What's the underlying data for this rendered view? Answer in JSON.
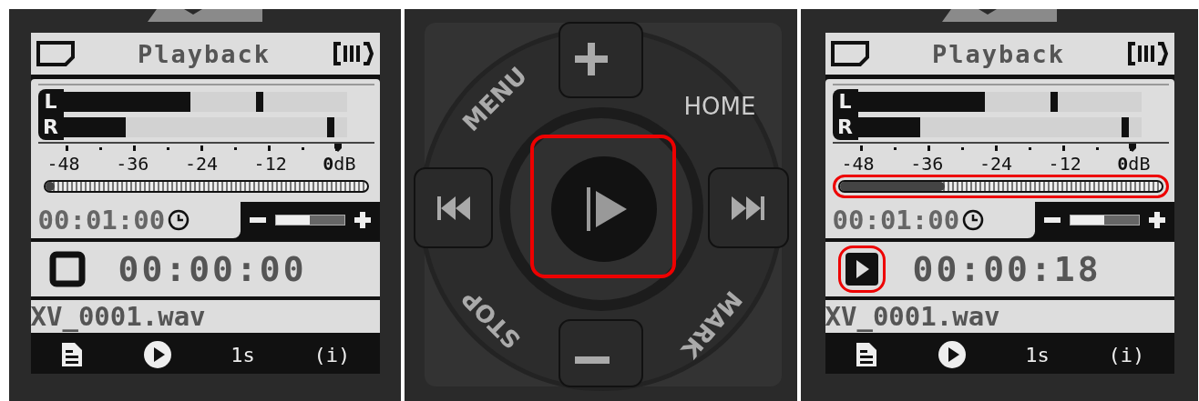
{
  "screens": [
    {
      "header": {
        "title": "Playback"
      },
      "meters": [
        {
          "label": "L",
          "level": 0.45,
          "peak": {
            "level": 0.68
          }
        },
        {
          "label": "R",
          "level": 0.22,
          "peak": {
            "level": 0.93
          }
        }
      ],
      "scale": [
        "-48",
        "-36",
        "-24",
        "-12",
        "**0**dB"
      ],
      "progress": {
        "level": 0,
        "highlighted": false
      },
      "timer": "00:01:00",
      "volume": {
        "level": 0.5
      },
      "transport": {
        "kind": "stop",
        "highlighted": false
      },
      "position": "00:00:00",
      "file": "XV_0001.wav",
      "footer": [
        "1s",
        "(i)"
      ]
    },
    {
      "header": {
        "title": "Playback"
      },
      "meters": [
        {
          "label": "L",
          "level": 0.45,
          "peak": {
            "level": 0.68
          }
        },
        {
          "label": "R",
          "level": 0.22,
          "peak": {
            "level": 0.93
          }
        }
      ],
      "scale": [
        "-48",
        "-36",
        "-24",
        "-12",
        "**0**dB"
      ],
      "progress": {
        "level": 0.3,
        "highlighted": true
      },
      "timer": "00:01:00",
      "volume": {
        "level": 0.5
      },
      "transport": {
        "kind": "play",
        "highlighted": true
      },
      "position": "00:00:18",
      "file": "XV_0001.wav",
      "footer": [
        "1s",
        "(i)"
      ]
    }
  ],
  "pad": {
    "buttons": [
      {
        "kind": "plus",
        "highlighted": false
      },
      {
        "kind": "minus",
        "highlighted": false
      },
      {
        "kind": "prev",
        "highlighted": false
      },
      {
        "kind": "next",
        "highlighted": false
      },
      {
        "kind": "play",
        "highlighted": true
      }
    ],
    "labels": [
      "MENU",
      "HOME",
      "STOP",
      "MARK"
    ]
  }
}
